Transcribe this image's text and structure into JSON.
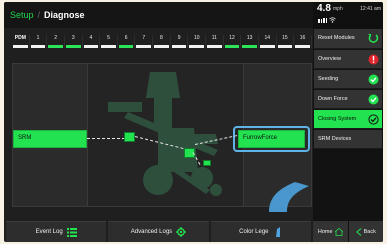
{
  "breadcrumb": {
    "parent": "Setup",
    "separator": "/",
    "current": "Diagnose"
  },
  "status": {
    "speed": "4.8",
    "speed_unit": "mph",
    "time": "12:41 am",
    "signal_icon": "signal-bars-icon"
  },
  "pdm": {
    "label": "PDM",
    "rows": [
      "1",
      "2",
      "3",
      "4",
      "5",
      "6",
      "7",
      "8",
      "9",
      "10",
      "11",
      "12",
      "13",
      "14",
      "15",
      "16"
    ],
    "row_status_colors": [
      "#f2f2f2",
      "#2de35a",
      "#2de35a",
      "#f2f2f2",
      "#f2f2f2",
      "#2de35a",
      "#f2f2f2",
      "#f2f2f2",
      "#f2f2f2",
      "#f2f2f2",
      "#f2f2f2",
      "#2de35a",
      "#2de35a",
      "#f2f2f2",
      "#f2f2f2",
      "#f2f2f2"
    ]
  },
  "diagram": {
    "left_label": "SRM",
    "right_label": "FurrowForce"
  },
  "bottom_buttons": {
    "event_log": "Event Log",
    "advanced_logs": "Advanced Logs",
    "color_legend": "Color Lege"
  },
  "sidebar": {
    "reset": "Reset Modules",
    "items": [
      {
        "label": "Overview",
        "status": "error",
        "icon": "error-icon"
      },
      {
        "label": "Seeding",
        "status": "ok",
        "icon": "check-icon"
      },
      {
        "label": "Down Force",
        "status": "ok",
        "icon": "check-icon"
      },
      {
        "label": "Closing System",
        "status": "ok",
        "icon": "check-icon",
        "active": true
      },
      {
        "label": "SRM Devices"
      }
    ],
    "home": "Home",
    "back": "Back"
  },
  "colors": {
    "accent": "#22e34f",
    "error": "#e0252c",
    "highlight": "#5fb3e6"
  }
}
